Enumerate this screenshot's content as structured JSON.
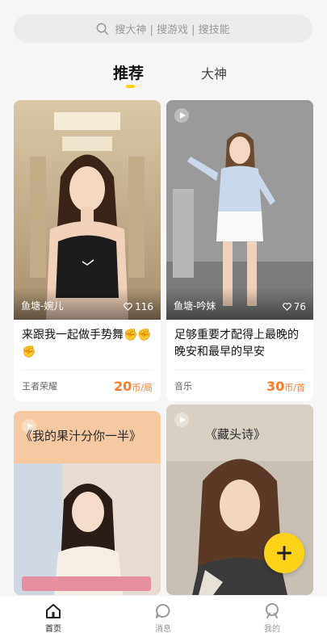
{
  "search": {
    "placeholder": "搜大神 | 搜游戏 | 搜技能",
    "icon": "search-icon"
  },
  "tabs": [
    {
      "label": "推荐",
      "active": true
    },
    {
      "label": "大神",
      "active": false
    }
  ],
  "feed": [
    {
      "nickname": "鱼塘-婉儿",
      "likes": "116",
      "title": "来跟我一起做手势舞✊✊✊",
      "category": "王者荣耀",
      "price": "20",
      "unit": "币/局",
      "has_play_icon": false
    },
    {
      "nickname": "鱼塘-吟妹",
      "likes": "76",
      "title": "足够重要才配得上最晚的晚安和最早的早安",
      "category": "音乐",
      "price": "30",
      "unit": "币/首",
      "has_play_icon": true
    },
    {
      "overlay_text": "《我的果汁分你一半》",
      "has_play_icon": true
    },
    {
      "overlay_text": "《藏头诗》",
      "has_play_icon": true
    }
  ],
  "fab": {
    "icon": "plus-icon"
  },
  "tabbar": [
    {
      "label": "首页",
      "icon": "home-icon",
      "active": true
    },
    {
      "label": "消息",
      "icon": "message-icon",
      "active": false
    },
    {
      "label": "我的",
      "icon": "profile-icon",
      "active": false
    }
  ],
  "colors": {
    "accent": "#ffd21a",
    "price": "#ff7a2a",
    "background": "#f6f6f6"
  }
}
